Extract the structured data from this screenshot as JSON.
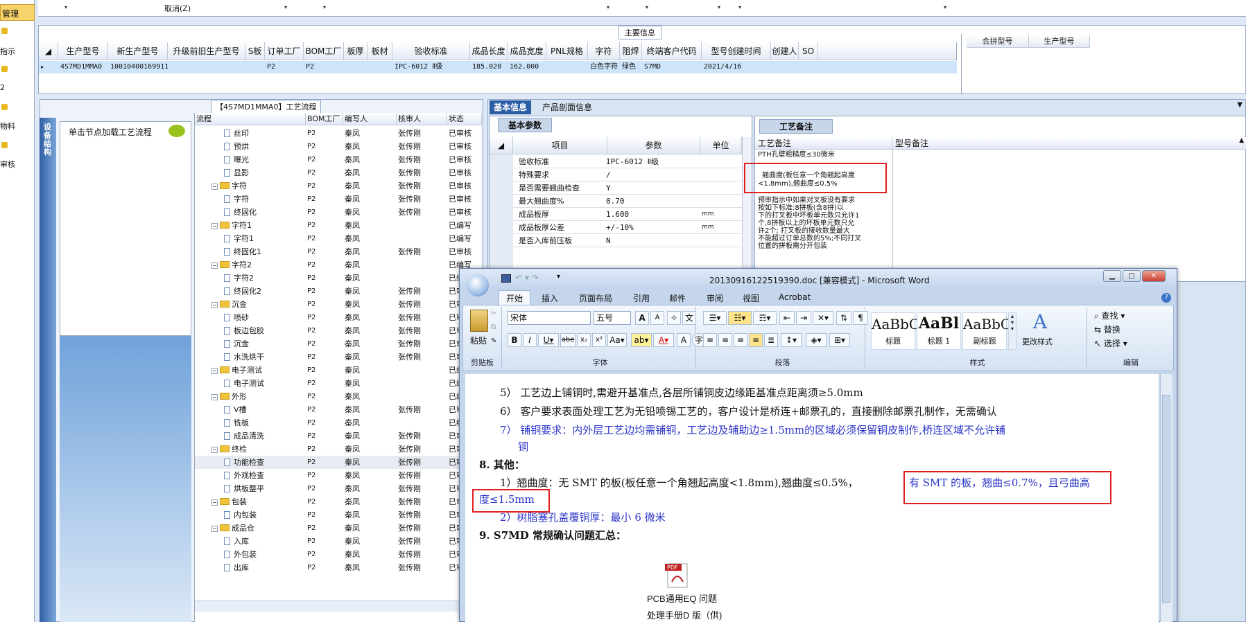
{
  "leftnav": {
    "selected": "管理",
    "items": [
      "指示",
      "2",
      "物料",
      "审核"
    ]
  },
  "topstrip": {
    "cancel": "取消(Z)"
  },
  "main": {
    "title": "主要信息",
    "headers": [
      "生产型号",
      "新生产型号",
      "升级前旧生产型号",
      "S板",
      "订单工厂",
      "BOM工厂",
      "板厚",
      "板材",
      "验收标准",
      "成品长度",
      "成品宽度",
      "PNL规格",
      "字符",
      "阻焊",
      "终端客户代码",
      "型号创建时间",
      "创建人",
      "SO"
    ],
    "row": [
      "4S7MD1MMA0",
      "10010400169911",
      "",
      "",
      "P2",
      "P2",
      "",
      "",
      "IPC-6012 Ⅱ级",
      "185.020",
      "162.000",
      "",
      "白色字符",
      "绿色",
      "S7MD",
      "2021/4/16",
      "",
      ""
    ],
    "side_headers": [
      "合拼型号",
      "生产型号"
    ]
  },
  "flow": {
    "title": "【4S7MD1MMA0】工艺流程",
    "sidebar_label": "设备结构",
    "hint": "单击节点加载工艺流程",
    "headers": [
      "流程",
      "BOM工厂",
      "编写人",
      "核审人",
      "状态"
    ],
    "rows": [
      {
        "name": "丝印",
        "level": 2,
        "type": "doc",
        "bom": "P2",
        "writer": "秦凤",
        "reviewer": "张传刚",
        "status": "已审核"
      },
      {
        "name": "预烘",
        "level": 2,
        "type": "doc",
        "bom": "P2",
        "writer": "秦凤",
        "reviewer": "张传刚",
        "status": "已审核"
      },
      {
        "name": "曝光",
        "level": 2,
        "type": "doc",
        "bom": "P2",
        "writer": "秦凤",
        "reviewer": "张传刚",
        "status": "已审核"
      },
      {
        "name": "显影",
        "level": 2,
        "type": "doc",
        "bom": "P2",
        "writer": "秦凤",
        "reviewer": "张传刚",
        "status": "已审核"
      },
      {
        "name": "字符",
        "level": 1,
        "type": "folder",
        "bom": "P2",
        "writer": "秦凤",
        "reviewer": "张传刚",
        "status": "已审核"
      },
      {
        "name": "字符",
        "level": 2,
        "type": "doc",
        "bom": "P2",
        "writer": "秦凤",
        "reviewer": "张传刚",
        "status": "已审核"
      },
      {
        "name": "终固化",
        "level": 2,
        "type": "doc",
        "bom": "P2",
        "writer": "秦凤",
        "reviewer": "张传刚",
        "status": "已审核"
      },
      {
        "name": "字符1",
        "level": 1,
        "type": "folder",
        "bom": "P2",
        "writer": "秦凤",
        "reviewer": "",
        "status": "已编写"
      },
      {
        "name": "字符1",
        "level": 2,
        "type": "doc",
        "bom": "P2",
        "writer": "秦凤",
        "reviewer": "",
        "status": "已编写"
      },
      {
        "name": "终固化1",
        "level": 2,
        "type": "doc",
        "bom": "P2",
        "writer": "秦凤",
        "reviewer": "张传刚",
        "status": "已审核"
      },
      {
        "name": "字符2",
        "level": 1,
        "type": "folder",
        "bom": "P2",
        "writer": "秦凤",
        "reviewer": "",
        "status": "已编写"
      },
      {
        "name": "字符2",
        "level": 2,
        "type": "doc",
        "bom": "P2",
        "writer": "秦凤",
        "reviewer": "",
        "status": "已编写"
      },
      {
        "name": "终固化2",
        "level": 2,
        "type": "doc",
        "bom": "P2",
        "writer": "秦凤",
        "reviewer": "张传刚",
        "status": "已审核"
      },
      {
        "name": "沉金",
        "level": 1,
        "type": "folder",
        "bom": "P2",
        "writer": "秦凤",
        "reviewer": "张传刚",
        "status": "已审核"
      },
      {
        "name": "喷砂",
        "level": 2,
        "type": "doc",
        "bom": "P2",
        "writer": "秦凤",
        "reviewer": "张传刚",
        "status": "已审核"
      },
      {
        "name": "板边包胶",
        "level": 2,
        "type": "doc",
        "bom": "P2",
        "writer": "秦凤",
        "reviewer": "张传刚",
        "status": "已审核"
      },
      {
        "name": "沉金",
        "level": 2,
        "type": "doc",
        "bom": "P2",
        "writer": "秦凤",
        "reviewer": "张传刚",
        "status": "已审核"
      },
      {
        "name": "水洗烘干",
        "level": 2,
        "type": "doc",
        "bom": "P2",
        "writer": "秦凤",
        "reviewer": "张传刚",
        "status": "已审核"
      },
      {
        "name": "电子测试",
        "level": 1,
        "type": "folder",
        "bom": "P2",
        "writer": "秦凤",
        "reviewer": "",
        "status": "已编写"
      },
      {
        "name": "电子测试",
        "level": 2,
        "type": "doc",
        "bom": "P2",
        "writer": "秦凤",
        "reviewer": "",
        "status": "已编写"
      },
      {
        "name": "外形",
        "level": 1,
        "type": "folder",
        "bom": "P2",
        "writer": "秦凤",
        "reviewer": "",
        "status": "已编写"
      },
      {
        "name": "V槽",
        "level": 2,
        "type": "doc",
        "bom": "P2",
        "writer": "秦凤",
        "reviewer": "张传刚",
        "status": "已审核"
      },
      {
        "name": "铣板",
        "level": 2,
        "type": "doc",
        "bom": "P2",
        "writer": "秦凤",
        "reviewer": "",
        "status": "已编写"
      },
      {
        "name": "成品清洗",
        "level": 2,
        "type": "doc",
        "bom": "P2",
        "writer": "秦凤",
        "reviewer": "张传刚",
        "status": "已审核"
      },
      {
        "name": "终检",
        "level": 1,
        "type": "folder",
        "bom": "P2",
        "writer": "秦凤",
        "reviewer": "张传刚",
        "status": "已审核"
      },
      {
        "name": "功能检查",
        "level": 2,
        "type": "doc",
        "bom": "P2",
        "writer": "秦凤",
        "reviewer": "张传刚",
        "status": "已审核"
      },
      {
        "name": "外观检查",
        "level": 2,
        "type": "doc",
        "bom": "P2",
        "writer": "秦凤",
        "reviewer": "张传刚",
        "status": "已审核"
      },
      {
        "name": "烘板整平",
        "level": 2,
        "type": "doc",
        "bom": "P2",
        "writer": "秦凤",
        "reviewer": "张传刚",
        "status": "已审核"
      },
      {
        "name": "包装",
        "level": 1,
        "type": "folder",
        "bom": "P2",
        "writer": "秦凤",
        "reviewer": "张传刚",
        "status": "已审核"
      },
      {
        "name": "内包装",
        "level": 2,
        "type": "doc",
        "bom": "P2",
        "writer": "秦凤",
        "reviewer": "张传刚",
        "status": "已审核"
      },
      {
        "name": "成品仓",
        "level": 1,
        "type": "folder",
        "bom": "P2",
        "writer": "秦凤",
        "reviewer": "张传刚",
        "status": "已审核"
      },
      {
        "name": "入库",
        "level": 2,
        "type": "doc",
        "bom": "P2",
        "writer": "秦凤",
        "reviewer": "张传刚",
        "status": "已审核"
      },
      {
        "name": "外包装",
        "level": 2,
        "type": "doc",
        "bom": "P2",
        "writer": "秦凤",
        "reviewer": "张传刚",
        "status": "已审核"
      },
      {
        "name": "出库",
        "level": 2,
        "type": "doc",
        "bom": "P2",
        "writer": "秦凤",
        "reviewer": "张传刚",
        "status": "已审核"
      }
    ]
  },
  "info": {
    "tabs": [
      "基本信息",
      "产品剖面信息"
    ],
    "basic_tab": "基本参数",
    "param_headers": [
      "项目",
      "参数",
      "单位"
    ],
    "params": [
      {
        "k": "验收标准",
        "v": "IPC-6012 Ⅱ级",
        "u": ""
      },
      {
        "k": "特殊要求",
        "v": "/",
        "u": ""
      },
      {
        "k": "是否需要翘曲检查",
        "v": "Y",
        "u": ""
      },
      {
        "k": "最大翘曲度%",
        "v": "0.70",
        "u": ""
      },
      {
        "k": "成品板厚",
        "v": "1.600",
        "u": "mm"
      },
      {
        "k": "成品板厚公差",
        "v": "+/-10%",
        "u": "mm"
      },
      {
        "k": "是否入库前压板",
        "v": "N",
        "u": ""
      }
    ],
    "notes_tab": "工艺备注",
    "notes_headers": [
      "工艺备注",
      "型号备注"
    ],
    "notes_lines": [
      "PTH孔壁粗糙度≤30微米",
      "翘曲度(板任意一个角翘起高度",
      "<1.8mm),翘曲度≤0.5%",
      "预审指示中如果对叉板没有要求",
      "按如下标准:8拼板(含8拼)以",
      "下的打叉板中坏板单元数只允许1",
      "个,8拼板以上的坏板单元数只允",
      "许2个; 打叉板的接收数量最大",
      "不能超过订单总数的5%;不同打叉",
      "位置的拼板需分开包装"
    ]
  },
  "word": {
    "title": "20130916122519390.doc [兼容模式] - Microsoft Word",
    "tabs": [
      "开始",
      "插入",
      "页面布局",
      "引用",
      "邮件",
      "审阅",
      "视图",
      "Acrobat"
    ],
    "clipboard": {
      "paste": "粘贴",
      "label": "剪贴板"
    },
    "font": {
      "name": "宋体",
      "size": "五号",
      "label": "字体"
    },
    "paragraph_label": "段落",
    "styles": [
      {
        "sample": "AaBbC",
        "name": "标题"
      },
      {
        "sample": "AaBl",
        "name": "标题 1"
      },
      {
        "sample": "AaBbC",
        "name": "副标题"
      }
    ],
    "change_styles": "更改样式",
    "styles_label": "样式",
    "editing": {
      "find": "查找",
      "replace": "替换",
      "select": "选择",
      "label": "编辑"
    },
    "doc": {
      "l5": "5） 工艺边上铺铜时,需避开基准点,各层所铺铜皮边缘距基准点距离须≥5.0mm",
      "l6": "6） 客户要求表面处理工艺为无铅喷锡工艺的，客户设计是桥连+邮票孔的，直接删除邮票孔制作，无需确认",
      "l7a": "7） 铺铜要求：内外层工艺边均需铺铜，工艺边及辅助边≥1.5mm的区域必须保留铜皮制作,桥连区域不允许铺",
      "l7b": "铜",
      "h8": "8.  其他：",
      "l81a": "1）翘曲度：无 SMT 的板(板任意一个角翘起高度<1.8mm),翘曲度≤0.5%，",
      "l81b": "有 SMT 的板，翘曲≤0.7%，且弓曲高",
      "l81c": "度≤1.5mm",
      "l82": "2）树脂塞孔盖覆铜厚：最小 6 微米",
      "h9": "9.  S7MD 常规确认问题汇总：",
      "pdf1": "PCB通用EQ 问题",
      "pdf2": "处理手册D 版（供)"
    }
  }
}
